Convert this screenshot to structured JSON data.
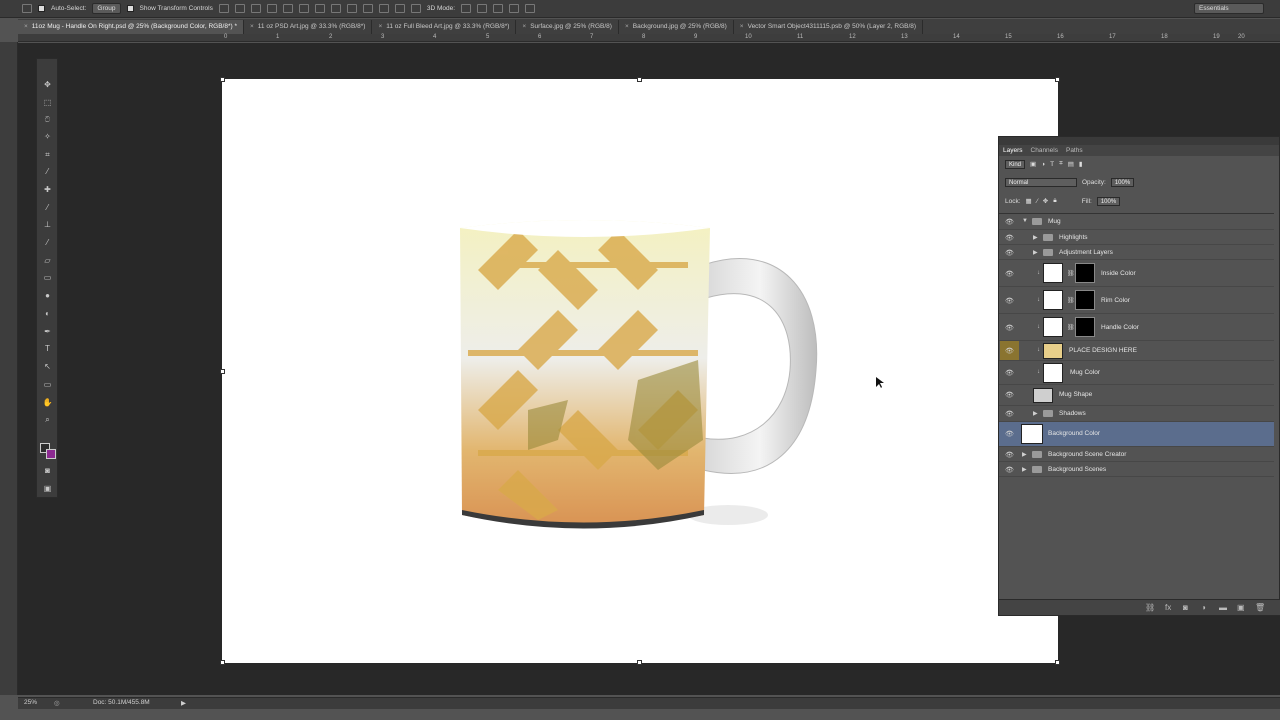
{
  "options_bar": {
    "auto_select_label": "Auto-Select:",
    "auto_select_value": "Group",
    "transform_label": "Show Transform Controls",
    "mode_label": "3D Mode:",
    "workspace": "Essentials"
  },
  "tabs": [
    {
      "label": "11oz Mug - Handle On Right.psd @ 25% (Background Color, RGB/8*) *"
    },
    {
      "label": "11 oz PSD Art.jpg @ 33.3% (RGB/8*)"
    },
    {
      "label": "11 oz Full Bleed Art.jpg @ 33.3% (RGB/8*)"
    },
    {
      "label": "Surface.jpg @ 25% (RGB/8)"
    },
    {
      "label": "Background.jpg @ 25% (RGB/8)"
    },
    {
      "label": "Vector Smart Object4311115.psb @ 50% (Layer 2, RGB/8)"
    }
  ],
  "ruler": {
    "top": [
      "0",
      "1",
      "2",
      "3",
      "4",
      "5",
      "6",
      "7",
      "8",
      "9",
      "10",
      "11",
      "12",
      "13",
      "14",
      "15",
      "16",
      "17",
      "18",
      "19",
      "20"
    ]
  },
  "status": {
    "zoom": "25%",
    "doc": "Doc: 50.1M/455.8M"
  },
  "layers_panel": {
    "tabs": [
      "Layers",
      "Channels",
      "Paths"
    ],
    "kind_label": "Kind",
    "blend_mode": "Normal",
    "opacity_label": "Opacity:",
    "opacity_value": "100%",
    "lock_label": "Lock:",
    "fill_label": "Fill:",
    "fill_value": "100%",
    "layers": [
      {
        "name": "Mug"
      },
      {
        "name": "Highlights"
      },
      {
        "name": "Adjustment Layers"
      },
      {
        "name": "Inside Color"
      },
      {
        "name": "Rim Color"
      },
      {
        "name": "Handle Color"
      },
      {
        "name": "PLACE DESIGN HERE"
      },
      {
        "name": "Mug Color"
      },
      {
        "name": "Mug Shape"
      },
      {
        "name": "Shadows"
      },
      {
        "name": "Background Color"
      },
      {
        "name": "Background Scene Creator"
      },
      {
        "name": "Background Scenes"
      }
    ]
  },
  "colors": {
    "foreground": "#2b2b2b",
    "background": "#8c2a91",
    "selected_layer": "#5b6d8d",
    "highlight_eye": "#8a7430"
  }
}
